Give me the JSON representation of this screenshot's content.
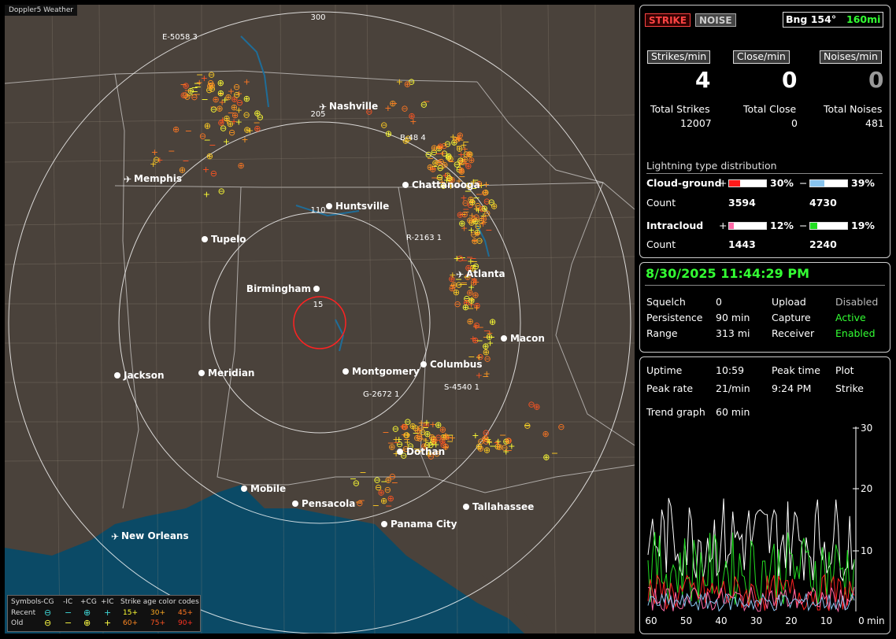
{
  "app_title": "Doppler5 Weather",
  "map": {
    "range_labels": [
      "300",
      "205",
      "110",
      "15"
    ],
    "cities": [
      {
        "name": "Nashville",
        "kind": "airport"
      },
      {
        "name": "Memphis",
        "kind": "airport"
      },
      {
        "name": "Chattanooga",
        "kind": "city"
      },
      {
        "name": "Huntsville",
        "kind": "city"
      },
      {
        "name": "Tupelo",
        "kind": "city"
      },
      {
        "name": "Atlanta",
        "kind": "airport"
      },
      {
        "name": "Birmingham",
        "kind": "city"
      },
      {
        "name": "Macon",
        "kind": "city"
      },
      {
        "name": "Jackson",
        "kind": "city"
      },
      {
        "name": "Meridian",
        "kind": "city"
      },
      {
        "name": "Montgomery",
        "kind": "city"
      },
      {
        "name": "Columbus",
        "kind": "city"
      },
      {
        "name": "Dothan",
        "kind": "city"
      },
      {
        "name": "Mobile",
        "kind": "city"
      },
      {
        "name": "Pensacola",
        "kind": "city"
      },
      {
        "name": "Tallahassee",
        "kind": "city"
      },
      {
        "name": "Panama City",
        "kind": "city"
      },
      {
        "name": "New Orleans",
        "kind": "airport"
      }
    ],
    "storms": [
      "E-5058 3",
      "B-48 4",
      "R-2163 1",
      "G-2672 1",
      "S-4540 1"
    ]
  },
  "legend": {
    "symbols_label": "Symbols",
    "cols": [
      "-CG",
      "-IC",
      "+CG",
      "+IC"
    ],
    "recent_label": "Recent",
    "old_label": "Old",
    "age_label": "Strike age color codes",
    "recent_ages": [
      "15+",
      "30+",
      "45+"
    ],
    "old_ages": [
      "60+",
      "75+",
      "90+"
    ]
  },
  "status": {
    "strike_btn": "STRIKE",
    "noise_btn": "NOISE",
    "bearing_label": "Bng 154°",
    "bearing_range": "160mi",
    "strikes_min_label": "Strikes/min",
    "close_min_label": "Close/min",
    "noises_min_label": "Noises/min",
    "strikes_min": "4",
    "close_min": "0",
    "noises_min": "0",
    "total_strikes_label": "Total Strikes",
    "total_close_label": "Total Close",
    "total_noises_label": "Total Noises",
    "total_strikes": "12007",
    "total_close": "0",
    "total_noises": "481"
  },
  "distribution": {
    "title": "Lightning type distribution",
    "cg_label": "Cloud-ground",
    "ic_label": "Intracloud",
    "count_label": "Count",
    "plus": "+",
    "minus": "−",
    "cg_pos_pct": "30%",
    "cg_neg_pct": "39%",
    "cg_pos_count": "3594",
    "cg_neg_count": "4730",
    "ic_pos_pct": "12%",
    "ic_neg_pct": "19%",
    "ic_pos_count": "1443",
    "ic_neg_count": "2240",
    "cg_pos_fill": 0.3,
    "cg_neg_fill": 0.39,
    "ic_pos_fill": 0.12,
    "ic_neg_fill": 0.19,
    "colors": {
      "cg_pos": "#ff1a1a",
      "cg_neg": "#88c4ee",
      "ic_pos": "#ff6aa8",
      "ic_neg": "#22dd22"
    }
  },
  "settings": {
    "datetime": "8/30/2025 11:44:29 PM",
    "squelch_label": "Squelch",
    "squelch": "0",
    "persistence_label": "Persistence",
    "persistence": "90 min",
    "range_label": "Range",
    "range": "313 mi",
    "upload_label": "Upload",
    "upload": "Disabled",
    "capture_label": "Capture",
    "capture": "Active",
    "receiver_label": "Receiver",
    "receiver": "Enabled"
  },
  "trend": {
    "uptime_label": "Uptime",
    "uptime": "10:59",
    "peak_time_label": "Peak time",
    "peak_time": "9:24 PM",
    "plot_label": "Plot",
    "plot": "Strike",
    "peak_rate_label": "Peak rate",
    "peak_rate": "21/min",
    "trend_label": "Trend graph",
    "trend_window": "60 min",
    "y_ticks": [
      "30",
      "20",
      "10"
    ],
    "x_ticks": [
      "60",
      "50",
      "40",
      "30",
      "20",
      "10",
      "0"
    ],
    "x_unit": "min"
  }
}
